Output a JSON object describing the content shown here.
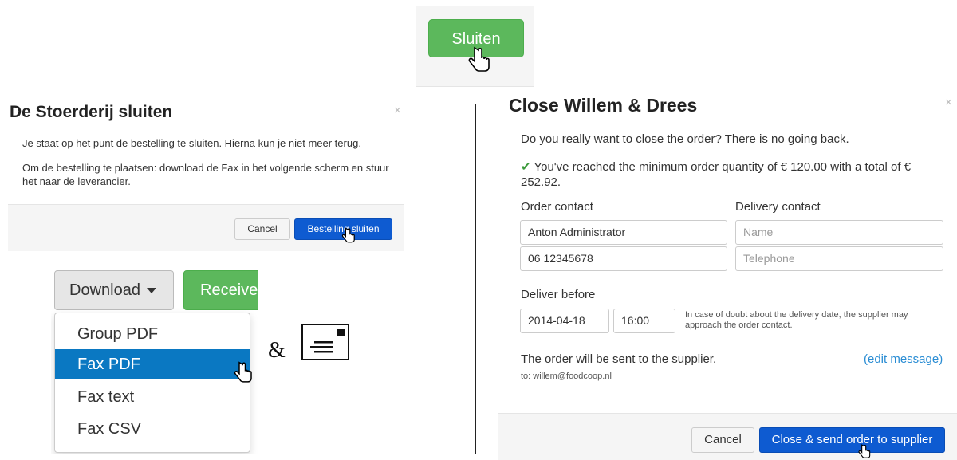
{
  "top_button": {
    "label": "Sluiten",
    "color": "#5cb85c"
  },
  "left_modal": {
    "title": "De Stoerderij sluiten",
    "close_symbol": "×",
    "paragraph1": "Je staat op het punt de bestelling te sluiten. Hierna kun je niet meer terug.",
    "paragraph2": "Om de bestelling te plaatsen: download de Fax in het volgende scherm en stuur het naar de leverancier.",
    "cancel_label": "Cancel",
    "confirm_label": "Bestelling sluiten",
    "primary_color": "#0e5bd1"
  },
  "download_menu": {
    "button_label": "Download",
    "receive_label": "Receive",
    "items": [
      {
        "label": "Group PDF",
        "active": false
      },
      {
        "label": "Fax PDF",
        "active": true
      },
      {
        "label": "Fax text",
        "active": false
      },
      {
        "label": "Fax CSV",
        "active": false
      }
    ],
    "active_color": "#0a78c2"
  },
  "connector": {
    "ampersand": "&",
    "icon": "fax-icon"
  },
  "right_modal": {
    "title": "Close Willem & Drees",
    "close_symbol": "×",
    "question": "Do you really want to close the order? There is no going back.",
    "check_icon": "✔",
    "min_quantity": "You've reached the minimum order quantity of € 120.00 with a total of € 252.92.",
    "order_contact_label": "Order contact",
    "delivery_contact_label": "Delivery contact",
    "order_contact_name": "Anton Administrator",
    "order_contact_phone": "06 12345678",
    "delivery_name_placeholder": "Name",
    "delivery_phone_placeholder": "Telephone",
    "deliver_before_label": "Deliver before",
    "deliver_date": "2014-04-18",
    "deliver_time": "16:00",
    "help_text": "In case of doubt about the delivery date, the supplier may approach the order contact.",
    "sent_text": "The order will be sent to the supplier.",
    "edit_link": "(edit message)",
    "to_text": "to: willem@foodcoop.nl",
    "cancel_label": "Cancel",
    "send_label": "Close & send order to supplier"
  }
}
